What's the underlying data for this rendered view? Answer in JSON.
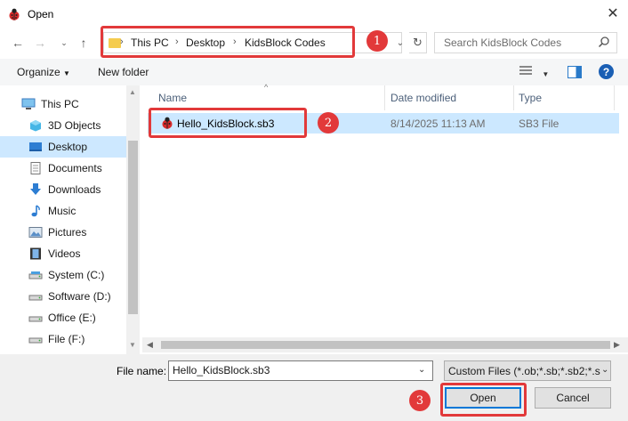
{
  "window": {
    "title": "Open"
  },
  "address": {
    "crumbs": [
      "This PC",
      "Desktop",
      "KidsBlock Codes"
    ]
  },
  "search": {
    "placeholder": "Search KidsBlock Codes"
  },
  "toolbar": {
    "organize_label": "Organize",
    "newfolder_label": "New folder"
  },
  "sidebar": {
    "items": [
      {
        "label": "This PC",
        "icon": "computer-icon"
      },
      {
        "label": "3D Objects",
        "icon": "cube-icon"
      },
      {
        "label": "Desktop",
        "icon": "desktop-icon",
        "selected": true
      },
      {
        "label": "Documents",
        "icon": "document-icon"
      },
      {
        "label": "Downloads",
        "icon": "download-icon"
      },
      {
        "label": "Music",
        "icon": "music-icon"
      },
      {
        "label": "Pictures",
        "icon": "picture-icon"
      },
      {
        "label": "Videos",
        "icon": "video-icon"
      },
      {
        "label": "System (C:)",
        "icon": "drive-icon"
      },
      {
        "label": "Software (D:)",
        "icon": "drive-icon"
      },
      {
        "label": "Office (E:)",
        "icon": "drive-icon"
      },
      {
        "label": "File (F:)",
        "icon": "drive-icon"
      }
    ]
  },
  "files": {
    "columns": [
      "Name",
      "Date modified",
      "Type"
    ],
    "rows": [
      {
        "name": "Hello_KidsBlock.sb3",
        "date": "8/14/2025 11:13 AM",
        "type": "SB3 File"
      }
    ]
  },
  "bottom": {
    "filename_label": "File name:",
    "filename_value": "Hello_KidsBlock.sb3",
    "filter_value": "Custom Files (*.ob;*.sb;*.sb2;*.s",
    "open_label": "Open",
    "cancel_label": "Cancel"
  },
  "annotations": [
    "1",
    "2",
    "3"
  ],
  "colors": {
    "annotation": "#e2393a",
    "selection": "#cce8ff",
    "accent": "#0078d7"
  }
}
